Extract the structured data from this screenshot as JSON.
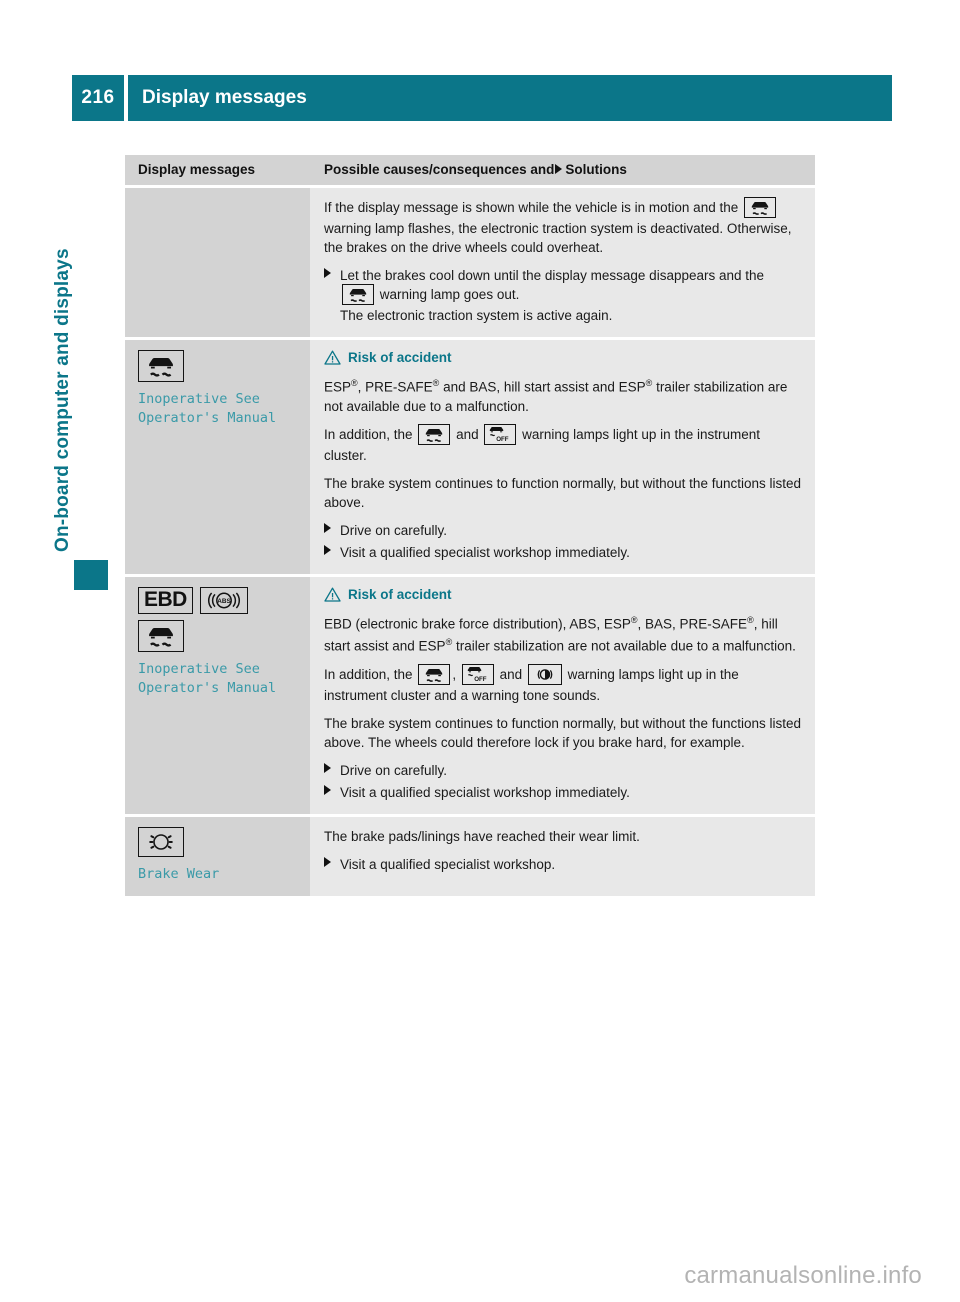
{
  "header": {
    "page_number": "216",
    "title": "Display messages",
    "bar_color": "#0b7689"
  },
  "sidebar": {
    "chapter_label": "On-board computer and displays",
    "accent_color": "#0b7689"
  },
  "table": {
    "columns": {
      "left_header": "Display messages",
      "right_header_before": "Possible causes/consequences and",
      "right_header_after": "Solutions"
    },
    "rows": [
      {
        "id": "row-traction-overheat",
        "left": {
          "icons": [],
          "message": ""
        },
        "right": {
          "warning": null,
          "paragraphs": [
            {
              "type": "para",
              "segments": [
                {
                  "text": "If the display message is shown while the vehicle is in motion and the "
                },
                {
                  "icon": "esp-skid-lamp"
                },
                {
                  "text": " warning lamp flashes, the electronic traction system is deactivated. Otherwise, the brakes on the drive wheels could overheat."
                }
              ]
            },
            {
              "type": "bullet",
              "segments": [
                {
                  "text": "Let the brakes cool down until the display message disappears and the "
                },
                {
                  "icon": "esp-skid-lamp"
                },
                {
                  "text": " warning lamp goes out."
                }
              ],
              "subline": "The electronic traction system is active again."
            }
          ]
        }
      },
      {
        "id": "row-esp-inoperative",
        "left": {
          "icons": [
            "esp-skid-lamp"
          ],
          "message": "Inoperative See\nOperator's Manual"
        },
        "right": {
          "warning": "Risk of accident",
          "paragraphs": [
            {
              "type": "para",
              "segments": [
                {
                  "text": "ESP"
                },
                {
                  "sup": "®"
                },
                {
                  "text": ", PRE-SAFE"
                },
                {
                  "sup": "®"
                },
                {
                  "text": " and BAS, hill start assist and ESP"
                },
                {
                  "sup": "®"
                },
                {
                  "text": " trailer stabilization are not available due to a malfunction."
                }
              ]
            },
            {
              "type": "para",
              "segments": [
                {
                  "text": "In addition, the "
                },
                {
                  "icon": "esp-skid-lamp"
                },
                {
                  "text": " and "
                },
                {
                  "icon": "esp-off-lamp"
                },
                {
                  "text": " warning lamps light up in the instrument cluster."
                }
              ]
            },
            {
              "type": "para",
              "segments": [
                {
                  "text": "The brake system continues to function normally, but without the functions listed above."
                }
              ]
            },
            {
              "type": "bullet",
              "segments": [
                {
                  "text": "Drive on carefully."
                }
              ]
            },
            {
              "type": "bullet",
              "segments": [
                {
                  "text": "Visit a qualified specialist workshop immediately."
                }
              ]
            }
          ]
        }
      },
      {
        "id": "row-ebd-inoperative",
        "left": {
          "icons": [
            "ebd-text-lamp",
            "abs-lamp",
            "esp-skid-lamp"
          ],
          "message": "Inoperative See\nOperator's Manual"
        },
        "right": {
          "warning": "Risk of accident",
          "paragraphs": [
            {
              "type": "para",
              "segments": [
                {
                  "text": "EBD (electronic brake force distribution), ABS, ESP"
                },
                {
                  "sup": "®"
                },
                {
                  "text": ", BAS, PRE-SAFE"
                },
                {
                  "sup": "®"
                },
                {
                  "text": ", hill start assist and ESP"
                },
                {
                  "sup": "®"
                },
                {
                  "text": " trailer stabilization are not available due to a malfunction."
                }
              ]
            },
            {
              "type": "para",
              "segments": [
                {
                  "text": "In addition, the "
                },
                {
                  "icon": "esp-skid-lamp"
                },
                {
                  "text": ", "
                },
                {
                  "icon": "esp-off-lamp"
                },
                {
                  "text": " and "
                },
                {
                  "icon": "brake-warning-lamp"
                },
                {
                  "text": " warning lamps light up in the instrument cluster and a warning tone sounds."
                }
              ]
            },
            {
              "type": "para",
              "segments": [
                {
                  "text": "The brake system continues to function normally, but without the functions listed above. The wheels could therefore lock if you brake hard, for example."
                }
              ]
            },
            {
              "type": "bullet",
              "segments": [
                {
                  "text": "Drive on carefully."
                }
              ]
            },
            {
              "type": "bullet",
              "segments": [
                {
                  "text": "Visit a qualified specialist workshop immediately."
                }
              ]
            }
          ]
        }
      },
      {
        "id": "row-brake-wear",
        "left": {
          "icons": [
            "brake-wear-lamp"
          ],
          "message": "Brake Wear"
        },
        "right": {
          "warning": null,
          "paragraphs": [
            {
              "type": "para",
              "segments": [
                {
                  "text": "The brake pads/linings have reached their wear limit."
                }
              ]
            },
            {
              "type": "bullet",
              "segments": [
                {
                  "text": "Visit a qualified specialist workshop."
                }
              ]
            }
          ]
        }
      }
    ]
  },
  "footer": {
    "watermark": "carmanualsonline.info"
  },
  "colors": {
    "teal": "#0b7689",
    "display_text_teal": "#3a9aa8",
    "col_left_bg": "#d3d3d3",
    "col_right_bg": "#e8e8e8"
  }
}
